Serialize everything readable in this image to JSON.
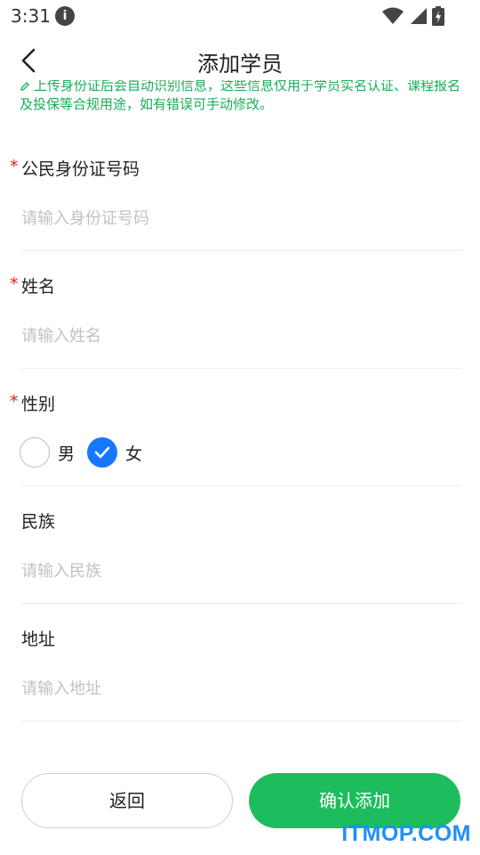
{
  "status_bar": {
    "time": "3:31",
    "info_icon": "i"
  },
  "header": {
    "title": "添加学员"
  },
  "notice": {
    "text": "上传身份证后会自动识别信息，这些信息仅用于学员实名认证、课程报名及投保等合规用途，如有错误可手动修改。"
  },
  "form": {
    "id_number": {
      "label": "公民身份证号码",
      "placeholder": "请输入身份证号码",
      "required": true
    },
    "name": {
      "label": "姓名",
      "placeholder": "请输入姓名",
      "required": true
    },
    "gender": {
      "label": "性别",
      "required": true,
      "options": [
        "男",
        "女"
      ],
      "selected": "女"
    },
    "ethnicity": {
      "label": "民族",
      "placeholder": "请输入民族"
    },
    "address": {
      "label": "地址",
      "placeholder": "请输入地址"
    },
    "required_mark": "*"
  },
  "actions": {
    "back_label": "返回",
    "confirm_label": "确认添加"
  },
  "watermark": "ITMOP.COM",
  "colors": {
    "accent_green": "#1dbd5d",
    "notice_green": "#1aad5a",
    "check_blue": "#1677ff",
    "required_red": "#e02020"
  }
}
